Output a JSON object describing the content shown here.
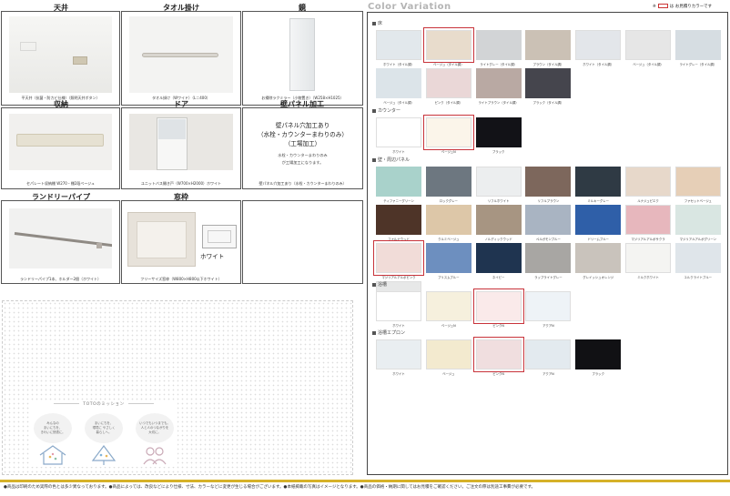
{
  "options": {
    "ceiling": {
      "title": "天井",
      "caption": "平天井（抗菌・防カビ仕様）（照明天井ボタン）"
    },
    "towel_bar": {
      "title": "タオル掛け",
      "caption": "タオル掛け（Wワイド）（L＝400）"
    },
    "mirror": {
      "title": "鏡",
      "caption": "お掃除ラクミラー（小物置き）（W258×H1025）"
    },
    "storage": {
      "title": "収納",
      "caption": "セパレート収納棚 W270・棚2段ベージュ"
    },
    "door": {
      "title": "ドア",
      "caption": "ユニットバス開き戸（W700×H2000）ホワイト"
    },
    "wall_panel": {
      "title": "壁パネル加工",
      "line1": "壁パネル穴加工あり",
      "line2": "（水栓・カウンターまわりのみ）",
      "line3": "（工場加工）",
      "note1": "水栓・カウンターまわりのみ",
      "note2": "が工場加工になります。",
      "caption": "壁パネル穴加工あり（水栓・カウンターまわりのみ）"
    },
    "laundry_pipe": {
      "title": "ランドリーパイプ",
      "caption": "ランドリーパイプ1本、ホルダー2個（ホワイト）"
    },
    "window_frame": {
      "title": "窓枠",
      "caption": "フリーサイズ窓枠（W800×H800以下ホワイト）",
      "label": "ホワイト"
    }
  },
  "mission": {
    "title": "TOTOのミッション",
    "items": [
      {
        "text1": "みんなの",
        "text2": "まいにちを、",
        "text3": "きれいに快適に。"
      },
      {
        "text1": "まいにちを、",
        "text2": "環境に やさしく",
        "text3": "暮らしへ。"
      },
      {
        "text1": "いつでもいつまでも。",
        "text2": "人と人のつながりを",
        "text3": "大切に。"
      }
    ]
  },
  "color_variation": {
    "title": "Color Variation",
    "legend_prefix": "※",
    "legend_text": "は お見積りカラーです",
    "sections": [
      {
        "label": "床",
        "swatches": [
          {
            "name": "ホワイト（タイル調）",
            "color": "#e2e8ec",
            "selected": false
          },
          {
            "name": "ベージュ（タイル調）",
            "color": "#e8dccc",
            "selected": true
          },
          {
            "name": "ライトグレー（タイル調）",
            "color": "#d2d4d6",
            "selected": false
          },
          {
            "name": "ブラウン（タイル調）",
            "color": "#cbc1b5",
            "selected": false
          },
          {
            "name": "ホワイト（タイル調）",
            "color": "#e3e6ea",
            "selected": false
          },
          {
            "name": "ベージュ（タイル調）",
            "color": "#e6e6e6",
            "selected": false
          },
          {
            "name": "ライトグレー（タイル調）",
            "color": "#d6dde2",
            "selected": false
          },
          {
            "name": "ベージュ（タイル調）",
            "color": "#dce4e9",
            "selected": false
          },
          {
            "name": "ピンク（タイル調）",
            "color": "#ead7d7",
            "selected": false
          },
          {
            "name": "ライトブラウン（タイル調）",
            "color": "#b9a9a3",
            "selected": false
          },
          {
            "name": "ブラック（タイル調）",
            "color": "#45454d",
            "selected": false
          }
        ]
      },
      {
        "label": "カウンター",
        "swatches": [
          {
            "name": "ホワイト",
            "color": "#ffffff",
            "selected": false
          },
          {
            "name": "ベージュN",
            "color": "#fbf5ea",
            "selected": true
          },
          {
            "name": "ブラック",
            "color": "#121217",
            "selected": false
          }
        ]
      },
      {
        "label": "壁・周辺パネル",
        "swatches": [
          {
            "name": "ティファニーグリーン",
            "color": "#a9d2cb",
            "selected": false
          },
          {
            "name": "ロックグレー",
            "color": "#6d7780",
            "selected": false
          },
          {
            "name": "リフルホワイト",
            "color": "#eceeef",
            "selected": false
          },
          {
            "name": "リフルブラウン",
            "color": "#7d675c",
            "selected": false
          },
          {
            "name": "ミルキーグレー",
            "color": "#2f3a44",
            "selected": false
          },
          {
            "name": "ルナジュピエク",
            "color": "#e7d8ca",
            "selected": false
          },
          {
            "name": "ファセットベージュ",
            "color": "#e6cfb7",
            "selected": false
          },
          {
            "name": "ファルナウッド",
            "color": "#4e3428",
            "selected": false
          },
          {
            "name": "クルミベージュ",
            "color": "#ddc7a8",
            "selected": false
          },
          {
            "name": "ノルディックウッド",
            "color": "#a79582",
            "selected": false
          },
          {
            "name": "ペルガモンブルー",
            "color": "#a9b4c2",
            "selected": false
          },
          {
            "name": "ドリームブルー",
            "color": "#2f5fa8",
            "selected": false
          },
          {
            "name": "マジリアルアルボサクラ",
            "color": "#e7b7bd",
            "selected": false
          },
          {
            "name": "マジリアルアルボグリーン",
            "color": "#d9e6e2",
            "selected": false
          },
          {
            "name": "マジリアルアルボピンク",
            "color": "#f1dcd8",
            "selected": true
          },
          {
            "name": "プリスムブルー",
            "color": "#6d8fbf",
            "selected": false
          },
          {
            "name": "ネイビー",
            "color": "#1f3450",
            "selected": false
          },
          {
            "name": "ラップライトグレー",
            "color": "#a8a6a3",
            "selected": false
          },
          {
            "name": "グレイッシュオレンジ",
            "color": "#c9c3bc",
            "selected": false
          },
          {
            "name": "ミルクホワイト",
            "color": "#f4f4f2",
            "selected": false
          },
          {
            "name": "ユルクライトブルー",
            "color": "#dfe5ea",
            "selected": false
          },
          {
            "name": "ユルクライトグレー",
            "color": "#e7e8e8",
            "selected": false
          }
        ]
      },
      {
        "label": "浴槽",
        "swatches": [
          {
            "name": "ホワイト",
            "color": "#ffffff",
            "selected": false
          },
          {
            "name": "ベージュN",
            "color": "#f6f0dd",
            "selected": false
          },
          {
            "name": "ピンクN",
            "color": "#faeaea",
            "selected": true
          },
          {
            "name": "アクアN",
            "color": "#eef3f7",
            "selected": false
          }
        ]
      },
      {
        "label": "浴槽エプロン",
        "swatches": [
          {
            "name": "ホワイト",
            "color": "#e9eef1",
            "selected": false
          },
          {
            "name": "ベージュ",
            "color": "#f3eacf",
            "selected": false
          },
          {
            "name": "ピンクN",
            "color": "#f0dedf",
            "selected": true
          },
          {
            "name": "アクアN",
            "color": "#e3eaef",
            "selected": false
          },
          {
            "name": "ブラック",
            "color": "#111114",
            "selected": false
          }
        ]
      }
    ]
  },
  "footer": {
    "disclaimer": "●商品は印刷のため実際の色とは多少異なっております。●商品によっては、改良などにより仕様、寸法、カラーなどに変更が生じる場合がございます。●本紙掲載の写真はイメージとなります。●商品の価格・納期に関してはお見積をご確認ください。ご注文の際は別途工事費が必要です。"
  }
}
